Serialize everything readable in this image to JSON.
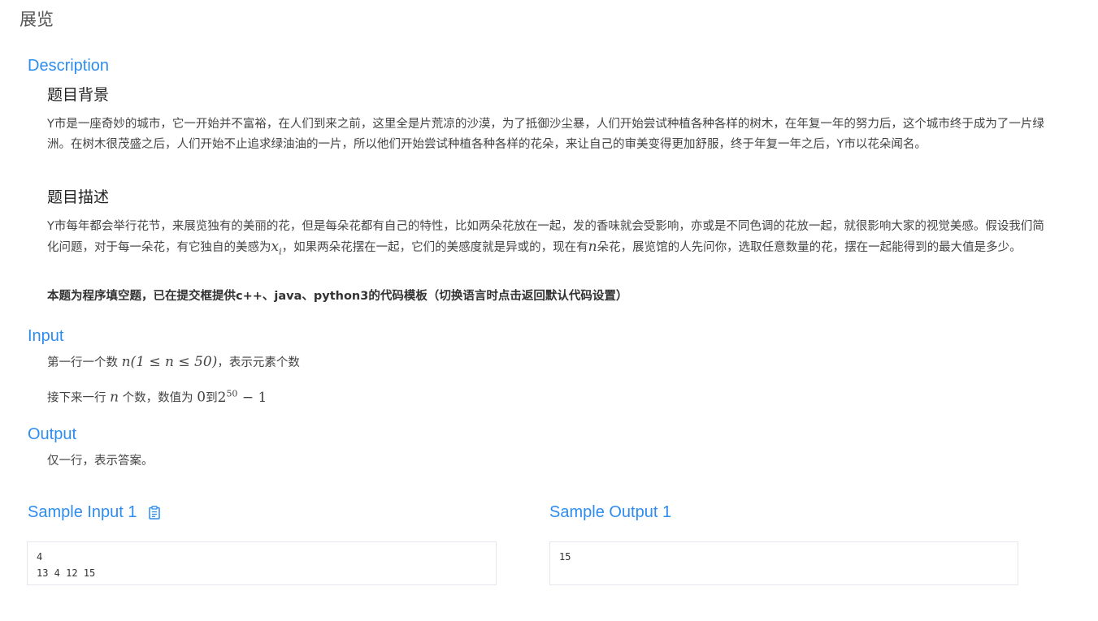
{
  "page": {
    "title": "展览"
  },
  "description": {
    "heading": "Description",
    "background_title": "题目背景",
    "background_text": "Y市是一座奇妙的城市，它一开始并不富裕，在人们到来之前，这里全是片荒凉的沙漠，为了抵御沙尘暴，人们开始尝试种植各种各样的树木，在年复一年的努力后，这个城市终于成为了一片绿洲。在树木很茂盛之后，人们开始不止追求绿油油的一片，所以他们开始尝试种植各种各样的花朵，来让自己的审美变得更加舒服，终于年复一年之后，Y市以花朵闻名。",
    "desc_title": "题目描述",
    "desc_text_1": "Y市每年都会举行花节，来展览独有的美丽的花，但是每朵花都有自己的特性，比如两朵花放在一起，发的香味就会受影响，亦或是不同色调的花放一起，就很影响大家的视觉美感。假设我们简化问题，对于每一朵花，有它独自的美感为",
    "desc_math_x": "x",
    "desc_math_i": "i",
    "desc_text_2": "，如果两朵花摆在一起，它们的美感度就是异或的，现在有",
    "desc_math_n": "n",
    "desc_text_3": "朵花，展览馆的人先问你，选取任意数量的花，摆在一起能得到的最大值是多少。",
    "note": "本题为程序填空题，已在提交框提供c++、java、python3的代码模板（切换语言时点击返回默认代码设置）"
  },
  "input": {
    "heading": "Input",
    "line1_prefix": "第一行一个数 ",
    "line1_math": "n(1 ≤ n ≤ 50)",
    "line1_suffix": "，表示元素个数",
    "line2_prefix": "接下来一行 ",
    "line2_math_n": "n",
    "line2_mid": " 个数，数值为 ",
    "line2_zero": "0",
    "line2_to": "到",
    "line2_base": "2",
    "line2_exp": "50",
    "line2_tail": " − 1"
  },
  "output": {
    "heading": "Output",
    "text": "仅一行，表示答案。"
  },
  "samples": {
    "input_title": "Sample Input 1",
    "input_value": "4\n13 4 12 15",
    "output_title": "Sample Output 1",
    "output_value": "15"
  },
  "icons": {
    "copy": "clipboard-icon"
  },
  "colors": {
    "accent": "#2d8cf0",
    "text": "#333333",
    "border": "#e4e7ed"
  }
}
